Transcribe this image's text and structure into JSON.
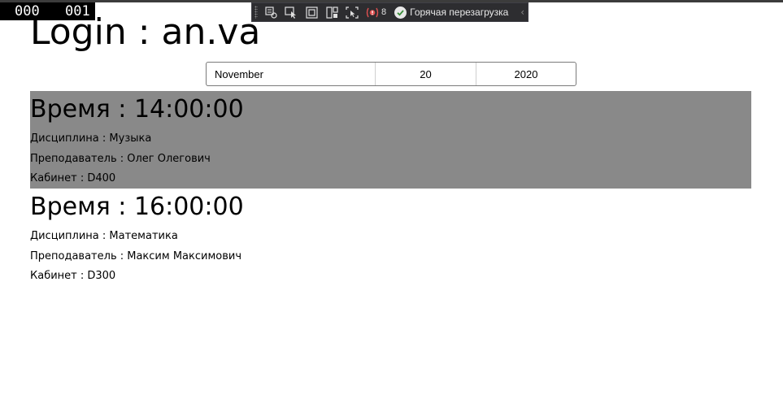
{
  "overlay": {
    "frame_counter_a": "000",
    "frame_counter_b": "001"
  },
  "debug_toolbar": {
    "binding_failures_count": "8",
    "hot_reload_label": "Горячая перезагрузка"
  },
  "page": {
    "login_label": "Login : an.va"
  },
  "date_picker": {
    "month": "November",
    "day": "20",
    "year": "2020"
  },
  "colors": {
    "selected_row": "#898989",
    "toolbar_bg": "#2d2d30"
  },
  "lessons": [
    {
      "time": "Время : 14:00:00",
      "discipline": "Дисциплина : Музыка",
      "teacher": "Преподаватель : Олег Олегович",
      "room": "Кабинет : D400",
      "selected": true
    },
    {
      "time": "Время : 16:00:00",
      "discipline": "Дисциплина : Математика",
      "teacher": "Преподаватель : Максим Максимович",
      "room": "Кабинет : D300",
      "selected": false
    }
  ]
}
